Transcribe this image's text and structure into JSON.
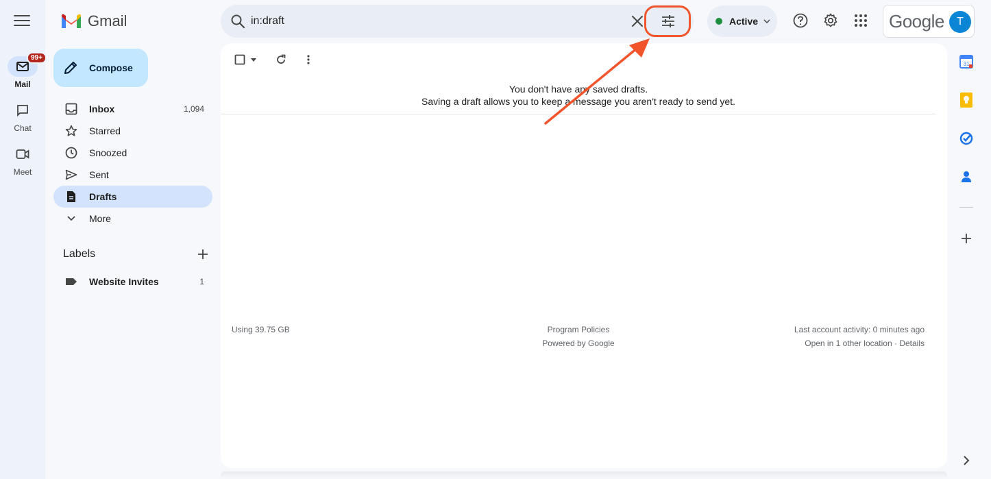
{
  "app": {
    "logo_text": "Gmail"
  },
  "rail": {
    "mail_label": "Mail",
    "mail_badge": "99+",
    "chat_label": "Chat",
    "meet_label": "Meet"
  },
  "search": {
    "value": "in:draft"
  },
  "status": {
    "label": "Active",
    "color": "#1e8e3e"
  },
  "account": {
    "brand": "Google",
    "avatar_letter": "T",
    "avatar_color": "#0b86d6"
  },
  "compose": {
    "label": "Compose"
  },
  "nav": {
    "items": [
      {
        "label": "Inbox",
        "count": "1,094",
        "icon": "inbox-icon"
      },
      {
        "label": "Starred",
        "count": "",
        "icon": "star-icon"
      },
      {
        "label": "Snoozed",
        "count": "",
        "icon": "clock-icon"
      },
      {
        "label": "Sent",
        "count": "",
        "icon": "send-icon"
      },
      {
        "label": "Drafts",
        "count": "",
        "icon": "draft-icon"
      },
      {
        "label": "More",
        "count": "",
        "icon": "chevron-down-icon"
      }
    ]
  },
  "labels": {
    "title": "Labels",
    "items": [
      {
        "label": "Website Invites",
        "count": "1"
      }
    ]
  },
  "main": {
    "empty_line1": "You don't have any saved drafts.",
    "empty_line2": "Saving a draft allows you to keep a message you aren't ready to send yet."
  },
  "footer": {
    "storage": "Using 39.75 GB",
    "policies": "Program Policies",
    "powered": "Powered by Google",
    "activity": "Last account activity: 0 minutes ago",
    "locations": "Open in 1 other location · Details"
  },
  "annotation": {
    "color": "#f2552c"
  }
}
